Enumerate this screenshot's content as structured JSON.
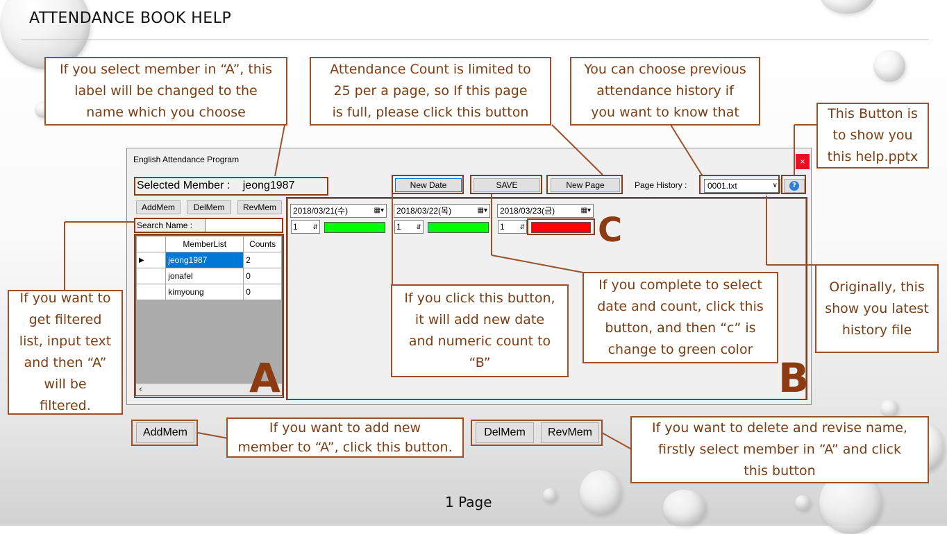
{
  "slide": {
    "title": "ATTENDANCE BOOK HELP",
    "page_label": "1 Page"
  },
  "colors": {
    "callout_border": "#9b4f2a",
    "callout_text": "#7a3d14",
    "bar_green": "#00ff00",
    "bar_red": "#ff0000",
    "selection_blue": "#0078d7"
  },
  "callouts": {
    "label_change": [
      "If you select member in “A”, this",
      "label will be changed to the",
      "name which you choose"
    ],
    "new_page": [
      "Attendance Count is limited to",
      "25 per a page, so If this page",
      "is full, please click this button"
    ],
    "history": [
      "You can choose previous",
      "attendance history if",
      "you want to know that"
    ],
    "help_button": [
      "This Button is",
      "to show you",
      "this help.pptx"
    ],
    "search": [
      "If you want to",
      "get filtered",
      "list, input text",
      "and then “A”",
      "will be",
      "filtered."
    ],
    "new_date": [
      "If you click this button,",
      "it will add new date",
      "and numeric count to",
      "“B”"
    ],
    "save": [
      "If you complete to select",
      "date and count, click this",
      "button, and then “c” is",
      "change to green color"
    ],
    "latest": [
      "Originally, this",
      "show you latest",
      "history file"
    ],
    "add": [
      "If you want to add new",
      "member to “A”, click this button."
    ],
    "delete": [
      "If you want to delete and revise name,",
      "firstly select member in “A” and click",
      "this button"
    ]
  },
  "app": {
    "window_title": "English Attendance Program",
    "close_label": "×",
    "selected_member_label": "Selected Member :",
    "selected_member_value": "jeong1987",
    "buttons": {
      "new_date": "New Date",
      "save": "SAVE",
      "new_page": "New Page",
      "add_mem": "AddMem",
      "del_mem": "DelMem",
      "rev_mem": "RevMem"
    },
    "page_history_label": "Page History :",
    "page_history_value": "0001.txt",
    "help_icon": "question-icon",
    "search_label": "Search Name :",
    "search_value": "",
    "member_table": {
      "headers": [
        "MemberList",
        "Counts"
      ],
      "rows": [
        {
          "name": "jeong1987",
          "count": "2"
        },
        {
          "name": "jonafel",
          "count": "0"
        },
        {
          "name": "kimyoung",
          "count": "0"
        }
      ]
    },
    "dates": [
      {
        "date": "2018/03/21(수)",
        "count": "1",
        "status": "green"
      },
      {
        "date": "2018/03/22(목)",
        "count": "1",
        "status": "green"
      },
      {
        "date": "2018/03/23(금)",
        "count": "1",
        "status": "red"
      }
    ],
    "region_letters": {
      "a": "A",
      "b": "B",
      "c": "C"
    }
  },
  "demo_buttons": {
    "add": "AddMem",
    "del": "DelMem",
    "rev": "RevMem"
  }
}
